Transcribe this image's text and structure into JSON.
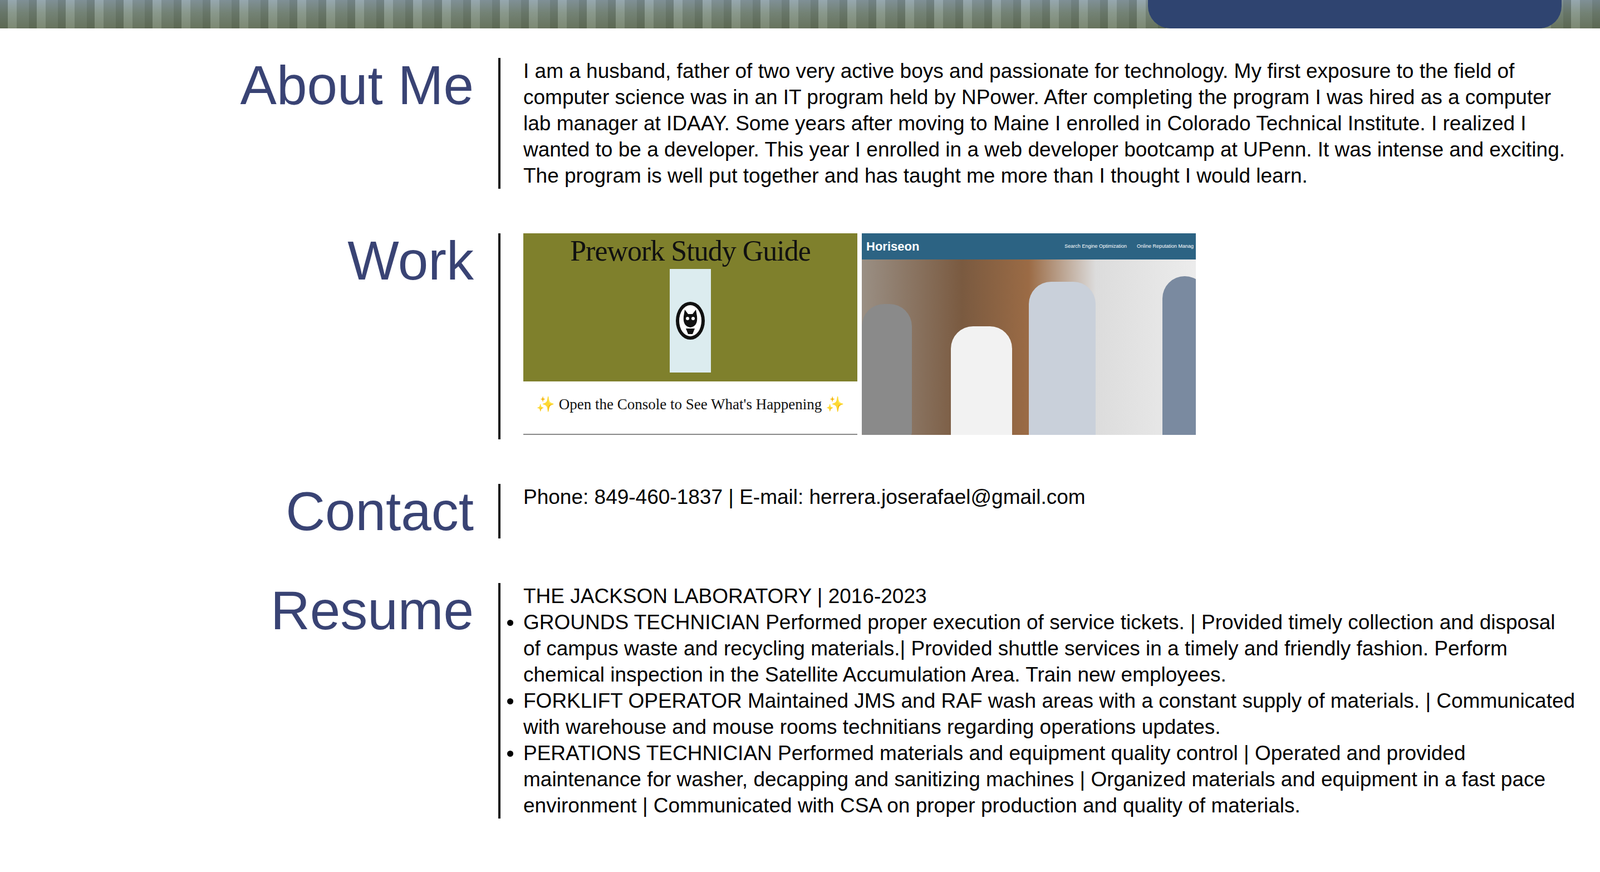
{
  "about": {
    "heading": "About Me",
    "text": "I am a husband, father of two very active boys and passionate for technology. My first exposure to the field of computer science was in an IT program held by NPower. After completing the program I was hired as a computer lab manager at IDAAY. Some years after moving to Maine I enrolled in Colorado Technical Institute. I realized I wanted to be a developer. This year I enrolled in a web developer bootcamp at UPenn. It was intense and exciting. The program is well put together and has taught me more than I thought I would learn."
  },
  "work": {
    "heading": "Work",
    "projects": [
      {
        "kind": "prework",
        "title": "Prework Study Guide",
        "subtitle": "✨ Open the Console to See What's Happening ✨"
      },
      {
        "kind": "horiseon",
        "brand": "Horiseon",
        "nav": [
          "Search Engine Optimization",
          "Online Reputation Manag"
        ]
      }
    ]
  },
  "contact": {
    "heading": "Contact",
    "text": "Phone: 849-460-1837 | E-mail: herrera.joserafael@gmail.com"
  },
  "resume": {
    "heading": "Resume",
    "employer": "THE JACKSON LABORATORY | 2016-2023",
    "items": [
      "GROUNDS TECHNICIAN Performed proper execution of service tickets. | Provided timely collection and disposal of campus waste and recycling materials.| Provided shuttle services in a timely and friendly fashion. Perform chemical inspection in the Satellite Accumulation Area. Train new employees.",
      "FORKLIFT OPERATOR Maintained JMS and RAF wash areas with a constant supply of materials. | Communicated with warehouse and mouse rooms technitians regarding operations updates.",
      "PERATIONS TECHNICIAN Performed materials and equipment quality control | Operated and provided maintenance for washer, decapping and sanitizing machines | Organized materials and equipment in a fast pace environment | Communicated with CSA on proper production and quality of materials."
    ]
  }
}
